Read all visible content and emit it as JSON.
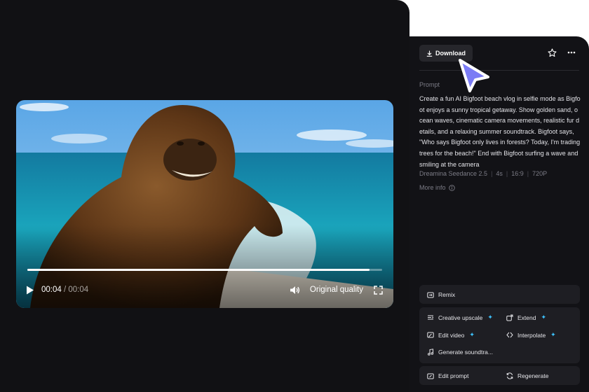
{
  "player": {
    "current_time": "00:04",
    "separator": "/",
    "total_time": "00:04",
    "quality_label": "Original quality",
    "progress": 0.965
  },
  "header": {
    "download_label": "Download"
  },
  "prompt": {
    "label": "Prompt",
    "text": "Create a fun AI Bigfoot beach vlog in selfie mode as Bigfoot enjoys a sunny tropical getaway. Show golden sand, ocean waves, cinematic camera movements, realistic fur details, and a relaxing summer soundtrack. Bigfoot says, \"Who says Bigfoot only lives in forests? Today, I'm trading trees for the beach!\" End with Bigfoot surfing a wave and smiling at the camera"
  },
  "meta": {
    "model": "Dreamina Seedance 2.5",
    "duration": "4s",
    "ratio": "16:9",
    "resolution": "720P"
  },
  "more_info_label": "More info",
  "actions": {
    "remix": "Remix",
    "creative_upscale": "Creative upscale",
    "extend": "Extend",
    "edit_video": "Edit video",
    "interpolate": "Interpolate",
    "generate_soundtrack": "Generate soundtra...",
    "edit_prompt": "Edit prompt",
    "regenerate": "Regenerate"
  },
  "colors": {
    "accent_sparkle": "#3ec3ff",
    "cursor": "#7b7cf5",
    "panel_bg": "#121216",
    "card_bg": "#1e1e23"
  }
}
